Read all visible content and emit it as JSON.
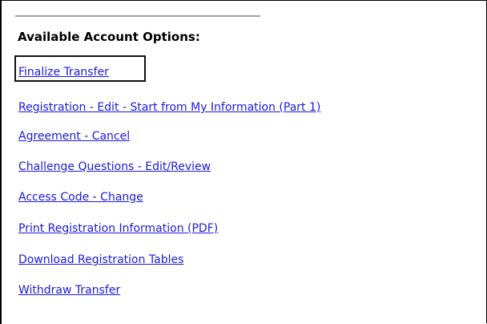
{
  "colors": {
    "link": "#1a1adb",
    "divider": "#a3a3a3",
    "frame": "#000000"
  },
  "heading": "Available Account Options:",
  "options": [
    {
      "label": "Finalize Transfer",
      "highlighted": true
    },
    {
      "label": "Registration - Edit - Start from My Information (Part 1)",
      "highlighted": false
    },
    {
      "label": "Agreement - Cancel",
      "highlighted": false
    },
    {
      "label": "Challenge Questions - Edit/Review",
      "highlighted": false
    },
    {
      "label": "Access Code - Change",
      "highlighted": false
    },
    {
      "label": "Print Registration Information (PDF)",
      "highlighted": false
    },
    {
      "label": "Download Registration Tables",
      "highlighted": false
    },
    {
      "label": "Withdraw Transfer",
      "highlighted": false
    }
  ]
}
